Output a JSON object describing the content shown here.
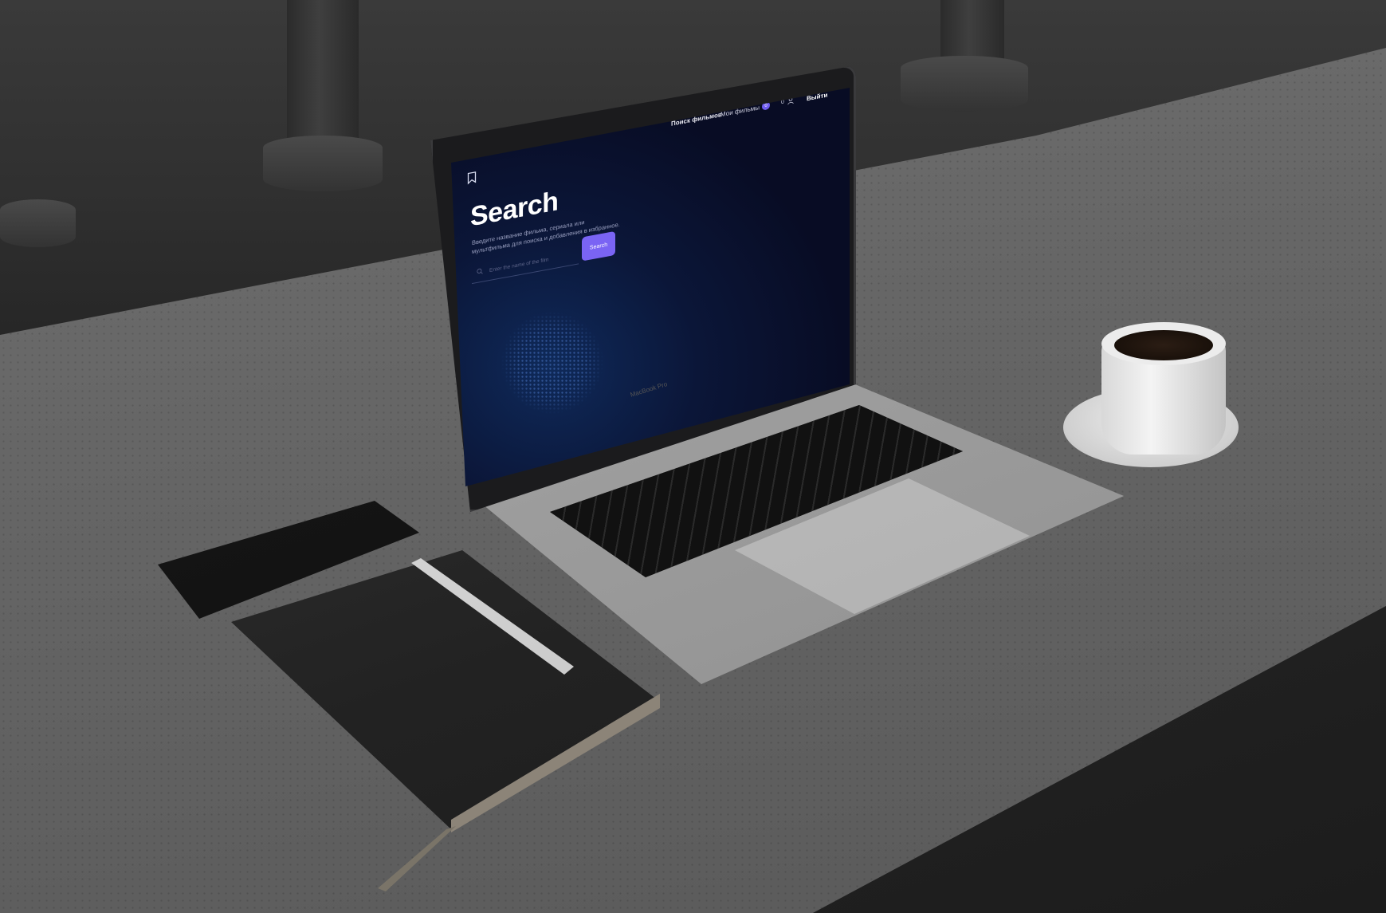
{
  "nav": {
    "film_search": "Поиск фильмов",
    "my_films": "Мои фильмы",
    "my_films_count": "0",
    "user_count": "0",
    "logout": "Выйти"
  },
  "main": {
    "title": "Search",
    "description": "Введите название фильма, сериала или мультфильма для поиска и добавления в избранное.",
    "search_placeholder": "Enter the name of the film",
    "search_button": "Search"
  },
  "device_label": "MacBook Pro",
  "colors": {
    "accent": "#7a64f4",
    "background": "#080c24",
    "text": "#ffffff"
  },
  "icons": {
    "logo": "bookmark-icon",
    "user": "user-icon",
    "search": "search-icon"
  }
}
